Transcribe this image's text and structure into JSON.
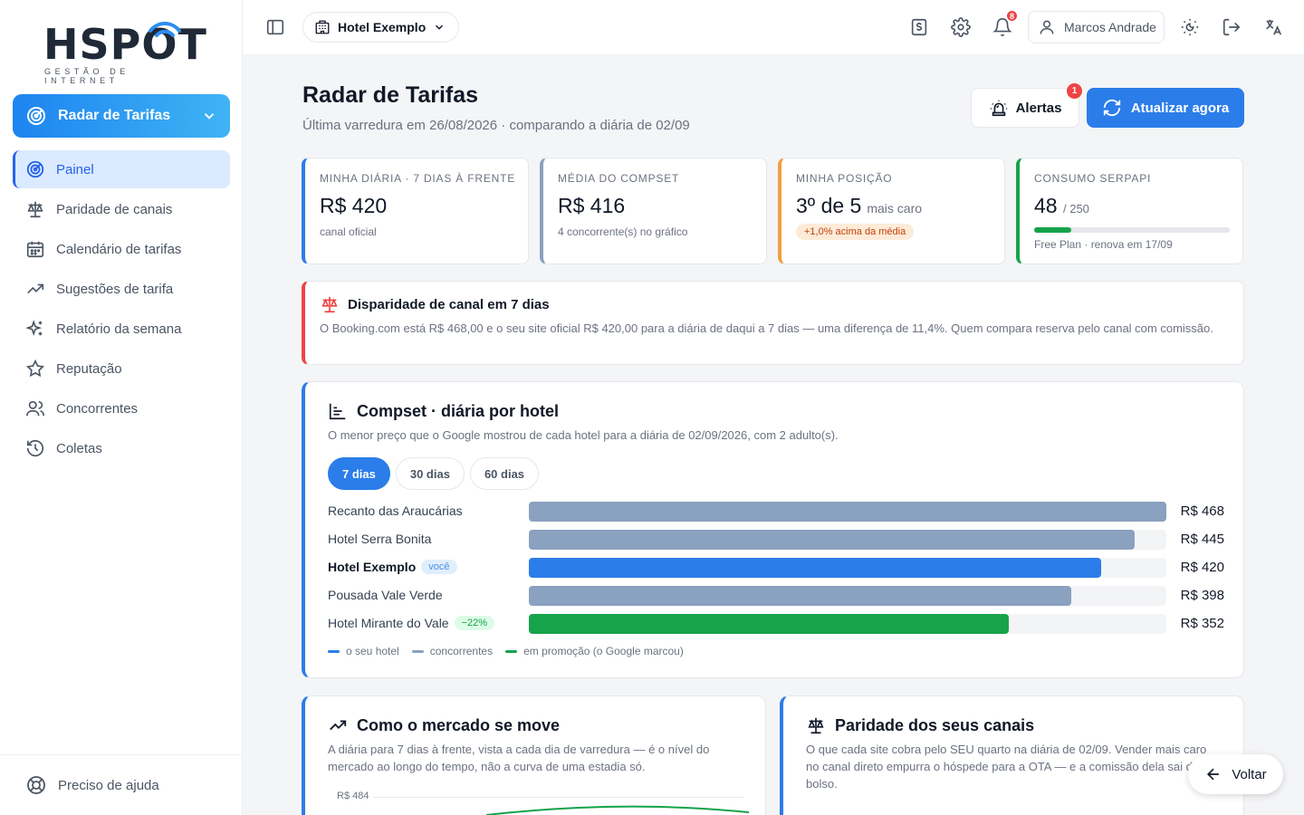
{
  "brand": {
    "logo_text": "HSPOT",
    "logo_sub": "GESTÃO DE INTERNET"
  },
  "sidebar": {
    "module": "Radar de Tarifas",
    "items": [
      {
        "label": "Painel",
        "icon": "radar-icon",
        "active": true
      },
      {
        "label": "Paridade de canais",
        "icon": "scale-icon"
      },
      {
        "label": "Calendário de tarifas",
        "icon": "calendar-icon"
      },
      {
        "label": "Sugestões de tarifa",
        "icon": "trending-up-icon"
      },
      {
        "label": "Relatório da semana",
        "icon": "sparkles-icon"
      },
      {
        "label": "Reputação",
        "icon": "star-icon"
      },
      {
        "label": "Concorrentes",
        "icon": "users-icon"
      },
      {
        "label": "Coletas",
        "icon": "history-icon"
      }
    ],
    "help": "Preciso de ajuda"
  },
  "topbar": {
    "hotel": "Hotel Exemplo",
    "notifications_count": "8",
    "user": "Marcos Andrade"
  },
  "header": {
    "title": "Radar de Tarifas",
    "subtitle": "Última varredura em 26/08/2026 · comparando a diária de 02/09",
    "alerts_label": "Alertas",
    "alerts_count": "1",
    "refresh_label": "Atualizar agora"
  },
  "kpis": [
    {
      "label": "Minha diária · 7 dias à frente",
      "value": "R$ 420",
      "sub": "canal oficial",
      "color": "#2b7de9"
    },
    {
      "label": "Média do compset",
      "value": "R$ 416",
      "sub": "4 concorrente(s) no gráfico",
      "color": "#8aa1bf"
    },
    {
      "label": "Minha posição",
      "value": "3º de 5",
      "suffix": "mais caro",
      "pill": "+1,0% acima da média",
      "color": "#f0a040"
    },
    {
      "label": "Consumo SerpApi",
      "value": "48",
      "value_small": "/ 250",
      "usage": 0.192,
      "sub": "Free Plan · renova em 17/09",
      "color": "#16a34a"
    }
  ],
  "alert": {
    "title": "Disparidade de canal em 7 dias",
    "body": "O Booking.com está R$ 468,00 e o seu site oficial R$ 420,00 para a diária de daqui a 7 dias — uma diferença de 11,4%. Quem compara reserva pelo canal com comissão."
  },
  "compset": {
    "title": "Compset · diária por hotel",
    "subtitle": "O menor preço que o Google mostrou de cada hotel para a diária de 02/09/2026, com 2 adulto(s).",
    "tabs": [
      "7 dias",
      "30 dias",
      "60 dias"
    ],
    "active_tab": 0,
    "scale_max": 468,
    "rows": [
      {
        "name": "Recanto das Araucárias",
        "value": 468,
        "label": "R$ 468",
        "kind": "competitor"
      },
      {
        "name": "Hotel Serra Bonita",
        "value": 445,
        "label": "R$ 445",
        "kind": "competitor"
      },
      {
        "name": "Hotel Exemplo",
        "value": 420,
        "label": "R$ 420",
        "kind": "mine",
        "tag": "você"
      },
      {
        "name": "Pousada Vale Verde",
        "value": 398,
        "label": "R$ 398",
        "kind": "competitor"
      },
      {
        "name": "Hotel Mirante do Vale",
        "value": 352,
        "label": "R$ 352",
        "kind": "promo",
        "tag": "−22%"
      }
    ],
    "colors": {
      "mine": "#2b7de9",
      "competitor": "#8aa1bf",
      "promo": "#16a34a"
    },
    "legend": [
      "o seu hotel",
      "concorrentes",
      "em promoção (o Google marcou)"
    ]
  },
  "market": {
    "title": "Como o mercado se move",
    "subtitle": "A diária para 7 dias à frente, vista a cada dia de varredura — é o nível do mercado ao longo do tempo, não a curva de uma estadia só.",
    "y_tick": "R$ 484"
  },
  "parity": {
    "title": "Paridade dos seus canais",
    "subtitle": "O que cada site cobra pelo SEU quarto na diária de 02/09. Vender mais caro no canal direto empurra o hóspede para a OTA — e a comissão dela sai do seu bolso."
  },
  "back_label": "Voltar"
}
